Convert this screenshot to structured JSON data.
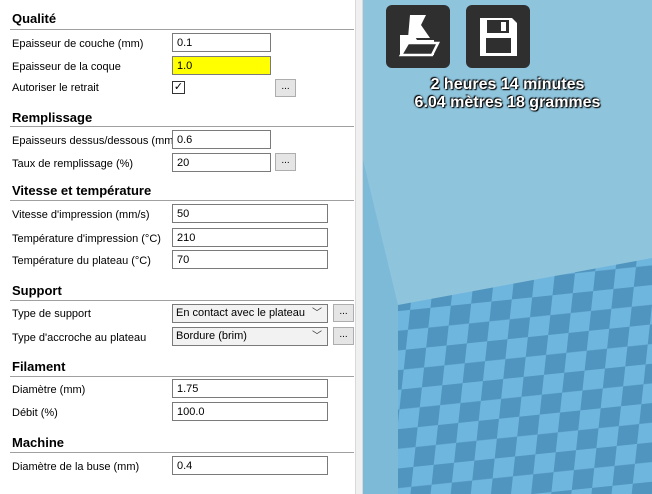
{
  "sections": {
    "quality": "Qualité",
    "fill": "Remplissage",
    "speed": "Vitesse et température",
    "support": "Support",
    "filament": "Filament",
    "machine": "Machine"
  },
  "quality": {
    "layer_height_label": "Epaisseur de couche (mm)",
    "layer_height_value": "0.1",
    "shell_thickness_label": "Epaisseur de la coque",
    "shell_thickness_value": "1.0",
    "retraction_label": "Autoriser le retrait",
    "retraction_checked": "✓",
    "more": "..."
  },
  "fill": {
    "top_bottom_label": "Epaisseurs dessus/dessous (mm)",
    "top_bottom_value": "0.6",
    "density_label": "Taux de remplissage (%)",
    "density_value": "20",
    "more": "..."
  },
  "speed": {
    "print_speed_label": "Vitesse d'impression (mm/s)",
    "print_speed_value": "50",
    "print_temp_label": "Température d'impression (°C)",
    "print_temp_value": "210",
    "bed_temp_label": "Température du plateau (°C)",
    "bed_temp_value": "70"
  },
  "support": {
    "type_label": "Type de support",
    "type_value": "En contact avec le plateau",
    "adhesion_label": "Type d'accroche au plateau",
    "adhesion_value": "Bordure (brim)",
    "more": "..."
  },
  "filament": {
    "diameter_label": "Diamètre (mm)",
    "diameter_value": "1.75",
    "flow_label": "Débit (%)",
    "flow_value": "100.0"
  },
  "machine": {
    "nozzle_label": "Diamètre de la buse (mm)",
    "nozzle_value": "0.4"
  },
  "viewport": {
    "print_time": "2 heures 14 minutes",
    "material": "6.04 mètres 18 grammes",
    "load_icon": "load-model-icon",
    "save_icon": "save-floppy-icon",
    "colors": {
      "background": "#8ec4dc",
      "bed_light": "#6fb6df",
      "bed_dark": "#4f95bf",
      "highlight": "#ffff00"
    }
  }
}
